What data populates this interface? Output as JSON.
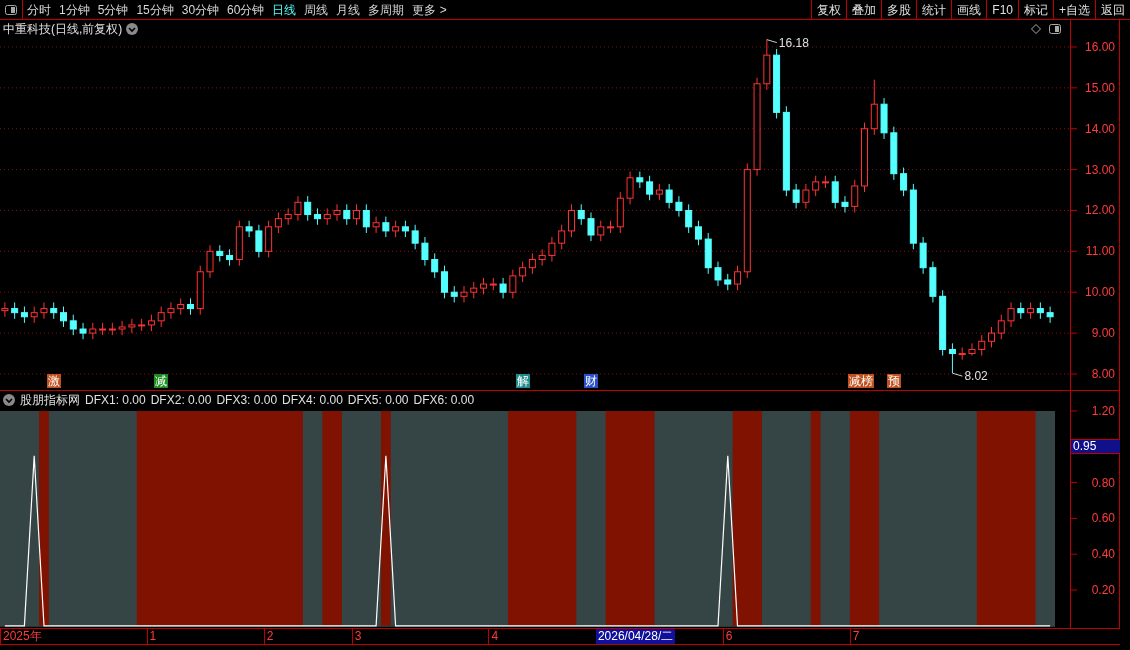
{
  "toolbar": {
    "periods": [
      {
        "label": "分时",
        "selected": false
      },
      {
        "label": "1分钟",
        "selected": false
      },
      {
        "label": "5分钟",
        "selected": false
      },
      {
        "label": "15分钟",
        "selected": false
      },
      {
        "label": "30分钟",
        "selected": false
      },
      {
        "label": "60分钟",
        "selected": false
      },
      {
        "label": "日线",
        "selected": true
      },
      {
        "label": "周线",
        "selected": false
      },
      {
        "label": "月线",
        "selected": false
      },
      {
        "label": "多周期",
        "selected": false
      },
      {
        "label": "更多 >",
        "selected": false
      }
    ],
    "buttons": [
      "复权",
      "叠加",
      "多股",
      "统计",
      "画线",
      "F10",
      "标记",
      "+自选",
      "返回"
    ]
  },
  "price_panel": {
    "title": "中重科技(日线,前复权)",
    "chart_data": {
      "type": "candlestick",
      "ylim": [
        7.608,
        16.66
      ],
      "grid": true,
      "yticks": [
        {
          "value": 8,
          "label": "8.00"
        },
        {
          "value": 9,
          "label": "9.00"
        },
        {
          "value": 10,
          "label": "10.00"
        },
        {
          "value": 11,
          "label": "11.00"
        },
        {
          "value": 12,
          "label": "12.00"
        },
        {
          "value": 13,
          "label": "13.00"
        },
        {
          "value": 14,
          "label": "14.00"
        },
        {
          "value": 15,
          "label": "15.00"
        },
        {
          "value": 16,
          "label": "16.00"
        }
      ],
      "ohlc": [
        [
          9.55,
          9.75,
          9.4,
          9.6
        ],
        [
          9.6,
          9.75,
          9.35,
          9.5
        ],
        [
          9.5,
          9.65,
          9.25,
          9.4
        ],
        [
          9.4,
          9.65,
          9.25,
          9.5
        ],
        [
          9.5,
          9.75,
          9.35,
          9.6
        ],
        [
          9.6,
          9.75,
          9.35,
          9.5
        ],
        [
          9.5,
          9.65,
          9.15,
          9.3
        ],
        [
          9.3,
          9.45,
          8.95,
          9.1
        ],
        [
          9.1,
          9.25,
          8.85,
          9.0
        ],
        [
          9.0,
          9.25,
          8.85,
          9.1
        ],
        [
          9.1,
          9.25,
          8.95,
          9.1
        ],
        [
          9.1,
          9.25,
          8.95,
          9.1
        ],
        [
          9.1,
          9.3,
          8.95,
          9.15
        ],
        [
          9.15,
          9.35,
          9.0,
          9.2
        ],
        [
          9.2,
          9.35,
          9.05,
          9.2
        ],
        [
          9.2,
          9.45,
          9.05,
          9.3
        ],
        [
          9.3,
          9.65,
          9.15,
          9.5
        ],
        [
          9.5,
          9.75,
          9.35,
          9.6
        ],
        [
          9.6,
          9.85,
          9.45,
          9.7
        ],
        [
          9.7,
          9.85,
          9.45,
          9.6
        ],
        [
          9.6,
          10.65,
          9.45,
          10.5
        ],
        [
          10.5,
          11.15,
          10.35,
          11.0
        ],
        [
          11.0,
          11.15,
          10.75,
          10.9
        ],
        [
          10.9,
          11.05,
          10.65,
          10.8
        ],
        [
          10.8,
          11.75,
          10.65,
          11.6
        ],
        [
          11.6,
          11.75,
          11.35,
          11.5
        ],
        [
          11.5,
          11.65,
          10.85,
          11.0
        ],
        [
          11.0,
          11.75,
          10.85,
          11.6
        ],
        [
          11.6,
          11.95,
          11.45,
          11.8
        ],
        [
          11.8,
          12.05,
          11.65,
          11.9
        ],
        [
          11.9,
          12.35,
          11.75,
          12.2
        ],
        [
          12.2,
          12.35,
          11.75,
          11.9
        ],
        [
          11.9,
          12.05,
          11.65,
          11.8
        ],
        [
          11.8,
          12.05,
          11.65,
          11.9
        ],
        [
          11.9,
          12.15,
          11.75,
          12.0
        ],
        [
          12.0,
          12.15,
          11.65,
          11.8
        ],
        [
          11.8,
          12.15,
          11.65,
          12.0
        ],
        [
          12.0,
          12.15,
          11.45,
          11.6
        ],
        [
          11.6,
          11.85,
          11.45,
          11.7
        ],
        [
          11.7,
          11.85,
          11.35,
          11.5
        ],
        [
          11.5,
          11.75,
          11.35,
          11.6
        ],
        [
          11.6,
          11.75,
          11.35,
          11.5
        ],
        [
          11.5,
          11.65,
          11.05,
          11.2
        ],
        [
          11.2,
          11.35,
          10.65,
          10.8
        ],
        [
          10.8,
          10.95,
          10.35,
          10.5
        ],
        [
          10.5,
          10.65,
          9.85,
          10.0
        ],
        [
          10.0,
          10.15,
          9.75,
          9.9
        ],
        [
          9.9,
          10.15,
          9.75,
          10.0
        ],
        [
          10.0,
          10.25,
          9.85,
          10.1
        ],
        [
          10.1,
          10.35,
          9.95,
          10.2
        ],
        [
          10.2,
          10.35,
          10.05,
          10.2
        ],
        [
          10.2,
          10.35,
          9.85,
          10.0
        ],
        [
          10.0,
          10.55,
          9.85,
          10.4
        ],
        [
          10.4,
          10.75,
          10.25,
          10.6
        ],
        [
          10.6,
          10.95,
          10.45,
          10.8
        ],
        [
          10.8,
          11.05,
          10.65,
          10.9
        ],
        [
          10.9,
          11.35,
          10.75,
          11.2
        ],
        [
          11.2,
          11.65,
          11.05,
          11.5
        ],
        [
          11.5,
          12.15,
          11.35,
          12.0
        ],
        [
          12.0,
          12.15,
          11.65,
          11.8
        ],
        [
          11.8,
          11.95,
          11.25,
          11.4
        ],
        [
          11.4,
          11.75,
          11.25,
          11.6
        ],
        [
          11.6,
          11.75,
          11.45,
          11.6
        ],
        [
          11.6,
          12.45,
          11.45,
          12.3
        ],
        [
          12.3,
          12.95,
          12.15,
          12.8
        ],
        [
          12.8,
          12.95,
          12.55,
          12.7
        ],
        [
          12.7,
          12.85,
          12.25,
          12.4
        ],
        [
          12.4,
          12.65,
          12.25,
          12.5
        ],
        [
          12.5,
          12.65,
          12.05,
          12.2
        ],
        [
          12.2,
          12.35,
          11.85,
          12.0
        ],
        [
          12.0,
          12.15,
          11.45,
          11.6
        ],
        [
          11.6,
          11.75,
          11.15,
          11.3
        ],
        [
          11.3,
          11.45,
          10.45,
          10.6
        ],
        [
          10.6,
          10.75,
          10.15,
          10.3
        ],
        [
          10.3,
          10.45,
          10.05,
          10.2
        ],
        [
          10.2,
          10.65,
          10.05,
          10.5
        ],
        [
          10.5,
          13.15,
          10.35,
          13.0
        ],
        [
          13.0,
          15.25,
          12.85,
          15.1
        ],
        [
          15.1,
          16.18,
          14.95,
          15.8
        ],
        [
          15.8,
          15.95,
          14.25,
          14.4
        ],
        [
          14.4,
          14.55,
          12.35,
          12.5
        ],
        [
          12.5,
          12.65,
          12.05,
          12.2
        ],
        [
          12.2,
          12.65,
          12.05,
          12.5
        ],
        [
          12.5,
          12.85,
          12.35,
          12.7
        ],
        [
          12.7,
          12.85,
          12.55,
          12.7
        ],
        [
          12.7,
          12.85,
          12.05,
          12.2
        ],
        [
          12.2,
          12.35,
          11.95,
          12.1
        ],
        [
          12.1,
          12.75,
          11.95,
          12.6
        ],
        [
          12.6,
          14.15,
          12.45,
          14.0
        ],
        [
          14.0,
          15.2,
          13.85,
          14.6
        ],
        [
          14.6,
          14.75,
          13.75,
          13.9
        ],
        [
          13.9,
          14.05,
          12.75,
          12.9
        ],
        [
          12.9,
          13.05,
          12.35,
          12.5
        ],
        [
          12.5,
          12.65,
          11.05,
          11.2
        ],
        [
          11.2,
          11.35,
          10.45,
          10.6
        ],
        [
          10.6,
          10.75,
          9.75,
          9.9
        ],
        [
          9.9,
          10.05,
          8.45,
          8.6
        ],
        [
          8.6,
          8.75,
          8.02,
          8.5
        ],
        [
          8.5,
          8.65,
          8.35,
          8.5
        ],
        [
          8.5,
          8.75,
          8.45,
          8.6
        ],
        [
          8.6,
          8.95,
          8.45,
          8.8
        ],
        [
          8.8,
          9.15,
          8.65,
          9.0
        ],
        [
          9.0,
          9.45,
          8.85,
          9.3
        ],
        [
          9.3,
          9.75,
          9.15,
          9.6
        ],
        [
          9.6,
          9.75,
          9.35,
          9.5
        ],
        [
          9.5,
          9.75,
          9.35,
          9.6
        ],
        [
          9.6,
          9.75,
          9.35,
          9.5
        ],
        [
          9.5,
          9.65,
          9.25,
          9.4
        ]
      ],
      "annotations": [
        "16.18",
        "8.02"
      ]
    },
    "events": [
      {
        "label": "激",
        "color": "#c0501e"
      },
      {
        "label": "减",
        "color": "#1e8c1e"
      },
      {
        "label": "解",
        "color": "#1e8c8c"
      },
      {
        "label": "财",
        "color": "#2a50c8"
      },
      {
        "label": "减榜",
        "color": "#c0501e"
      },
      {
        "label": "预",
        "color": "#c0501e"
      }
    ]
  },
  "indicator_panel": {
    "name": "股朋指标网",
    "values": [
      "DFX1: 0.00",
      "DFX2: 0.00",
      "DFX3: 0.00",
      "DFX4: 0.00",
      "DFX5: 0.00",
      "DFX6: 0.00"
    ],
    "cursor_value": "0.95",
    "cursor_date": "2026/04/28/二",
    "axis_labels": [
      "2025年",
      "1",
      "2",
      "3",
      "4",
      "6",
      "7"
    ],
    "chart_data": {
      "type": "area",
      "ylim": [
        0,
        1.2
      ],
      "yticks": [
        {
          "value": 0.2,
          "label": "0.20"
        },
        {
          "value": 0.4,
          "label": "0.40"
        },
        {
          "value": 0.6,
          "label": "0.60"
        },
        {
          "value": 0.8,
          "label": "0.80"
        },
        {
          "value": 1.2,
          "label": "1.20"
        }
      ],
      "series": [
        {
          "color": "#7f1200",
          "values": [
            0,
            0,
            0,
            0,
            1.2,
            0,
            0,
            0,
            0,
            0,
            0,
            0,
            0,
            0,
            1.2,
            1.2,
            1.2,
            1.2,
            1.2,
            1.2,
            1.2,
            1.2,
            1.2,
            1.2,
            1.2,
            1.2,
            1.2,
            1.2,
            1.2,
            1.2,
            1.2,
            0,
            0,
            1.2,
            1.2,
            0,
            0,
            0,
            0,
            1.2,
            0,
            0,
            0,
            0,
            0,
            0,
            0,
            0,
            0,
            0,
            0,
            0,
            1.2,
            1.2,
            1.2,
            1.2,
            1.2,
            1.2,
            1.2,
            0,
            0,
            0,
            1.2,
            1.2,
            1.2,
            1.2,
            1.2,
            0,
            0,
            0,
            0,
            0,
            0,
            0,
            0,
            1.2,
            1.2,
            1.2,
            0,
            0,
            0,
            0,
            0,
            1.2,
            0,
            0,
            0,
            1.2,
            1.2,
            1.2,
            0,
            0,
            0,
            0,
            0,
            0,
            0,
            0,
            0,
            0,
            1.2,
            1.2,
            1.2,
            1.2,
            1.2,
            1.2,
            0,
            0
          ]
        },
        {
          "type": "line",
          "color": "#ffffff",
          "values": [
            0,
            0,
            0,
            0.95,
            0,
            0,
            0,
            0,
            0,
            0,
            0,
            0,
            0,
            0,
            0,
            0,
            0,
            0,
            0,
            0,
            0,
            0,
            0,
            0,
            0,
            0,
            0,
            0,
            0,
            0,
            0,
            0,
            0,
            0,
            0,
            0,
            0,
            0,
            0,
            0.95,
            0,
            0,
            0,
            0,
            0,
            0,
            0,
            0,
            0,
            0,
            0,
            0,
            0,
            0,
            0,
            0,
            0,
            0,
            0,
            0,
            0,
            0,
            0,
            0,
            0,
            0,
            0,
            0,
            0,
            0,
            0,
            0,
            0,
            0,
            0.95,
            0,
            0,
            0,
            0,
            0,
            0,
            0,
            0,
            0,
            0,
            0,
            0,
            0,
            0,
            0,
            0,
            0,
            0,
            0,
            0,
            0,
            0,
            0,
            0,
            0,
            0,
            0,
            0,
            0,
            0,
            0,
            0,
            0
          ]
        }
      ]
    }
  }
}
